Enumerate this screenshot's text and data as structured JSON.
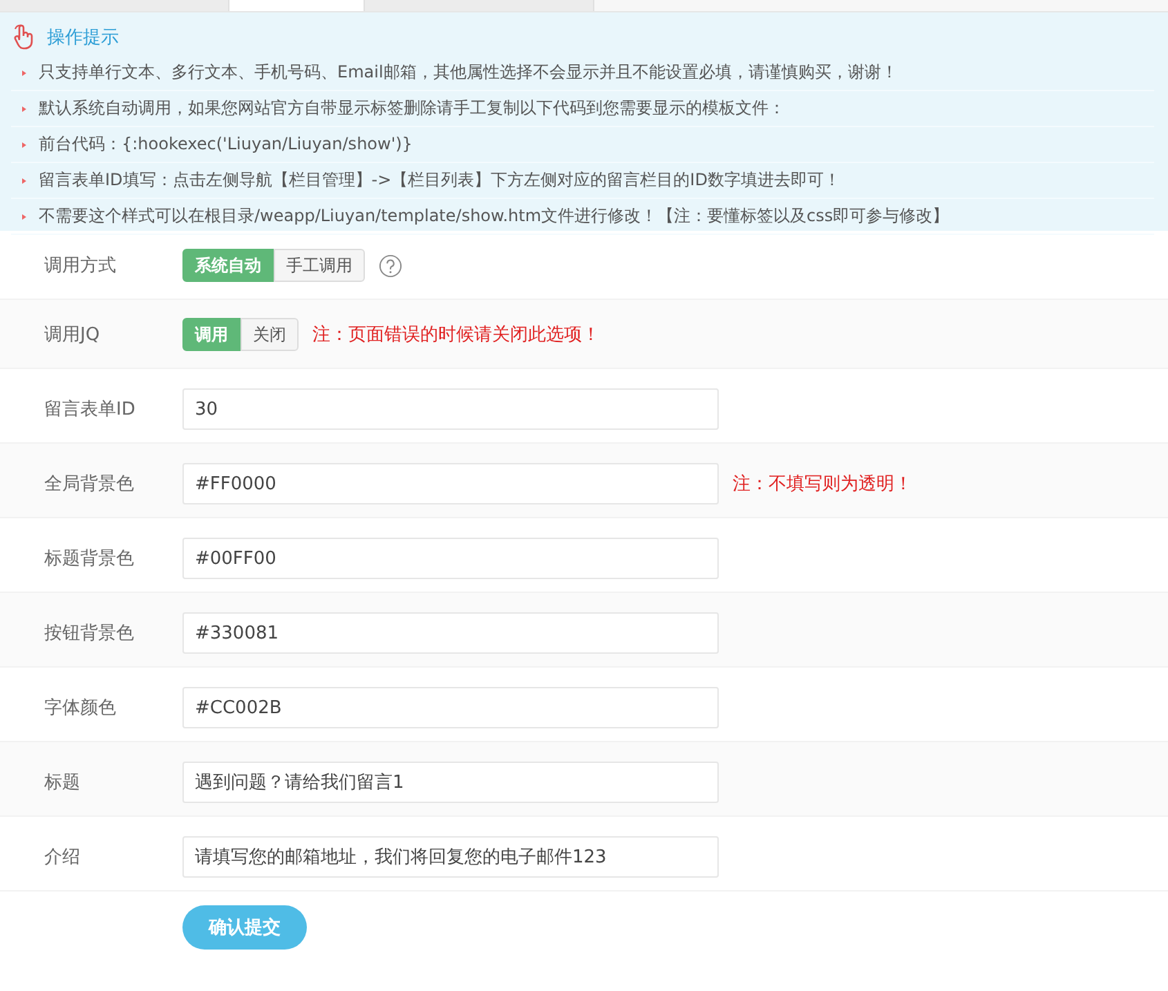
{
  "tabs": [
    {
      "selected": false
    },
    {
      "selected": true
    },
    {
      "selected": false
    }
  ],
  "tips": {
    "title": "操作提示",
    "items": [
      "只支持单行文本、多行文本、手机号码、Email邮箱，其他属性选择不会显示并且不能设置必填，请谨慎购买，谢谢！",
      "默认系统自动调用，如果您网站官方自带显示标签删除请手工复制以下代码到您需要显示的模板文件：",
      "前台代码：{:hookexec('Liuyan/Liuyan/show')}",
      "留言表单ID填写：点击左侧导航【栏目管理】->【栏目列表】下方左侧对应的留言栏目的ID数字填进去即可！",
      "不需要这个样式可以在根目录/weapp/Liuyan/template/show.htm文件进行修改！【注：要懂标签以及css即可参与修改】"
    ]
  },
  "form": [
    {
      "kind": "toggle",
      "label": "调用方式",
      "options": [
        {
          "label": "系统自动",
          "selected": true
        },
        {
          "label": "手工调用",
          "selected": false
        }
      ],
      "help": true
    },
    {
      "kind": "toggle",
      "label": "调用JQ",
      "options": [
        {
          "label": "调用",
          "selected": true
        },
        {
          "label": "关闭",
          "selected": false
        }
      ],
      "note": "注：页面错误的时候请关闭此选项！"
    },
    {
      "kind": "input",
      "label": "留言表单ID",
      "value": "30"
    },
    {
      "kind": "input",
      "label": "全局背景色",
      "value": "#FF0000",
      "note": "注：不填写则为透明！"
    },
    {
      "kind": "input",
      "label": "标题背景色",
      "value": "#00FF00"
    },
    {
      "kind": "input",
      "label": "按钮背景色",
      "value": "#330081"
    },
    {
      "kind": "input",
      "label": "字体颜色",
      "value": "#CC002B"
    },
    {
      "kind": "input",
      "label": "标题",
      "value": "遇到问题？请给我们留言1"
    },
    {
      "kind": "input",
      "label": "介绍",
      "value": "请填写您的邮箱地址，我们将回复您的电子邮件123"
    }
  ],
  "submit": "确认提交"
}
